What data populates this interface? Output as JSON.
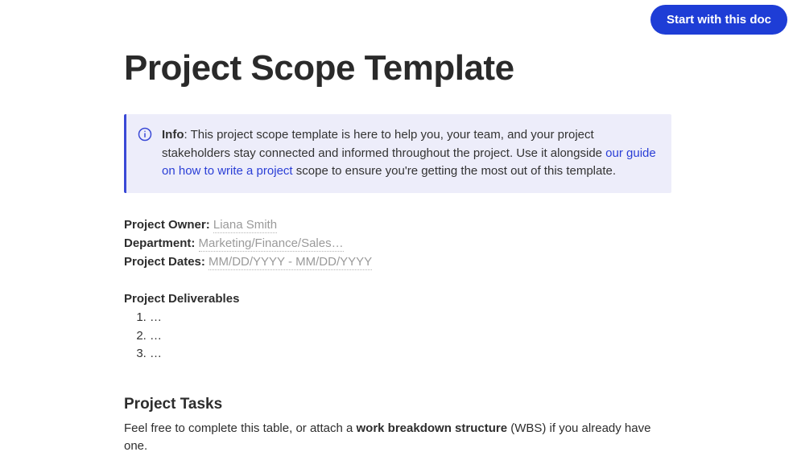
{
  "cta": {
    "label": "Start with this doc"
  },
  "title": "Project Scope Template",
  "info": {
    "prefix": "Info",
    "body1": ": This project scope template is here to help you, your team, and your project stakeholders stay connected and informed throughout the project. Use it alongside ",
    "link": "our guide on how to write a project",
    "body2": " scope to ensure you're getting the most out of this template."
  },
  "meta": {
    "owner_label": "Project Owner: ",
    "owner_value": "Liana Smith ",
    "department_label": "Department: ",
    "department_value": "Marketing/Finance/Sales…",
    "dates_label": "Project Dates: ",
    "dates_value": "MM/DD/YYYY - MM/DD/YYYY"
  },
  "deliverables": {
    "heading": "Project Deliverables",
    "items": [
      "…",
      "…",
      "…"
    ]
  },
  "tasks": {
    "heading": "Project Tasks",
    "text1": "Feel free to complete this table, or attach a ",
    "bold": "work breakdown structure",
    "text2": " (WBS) if you already have one."
  }
}
